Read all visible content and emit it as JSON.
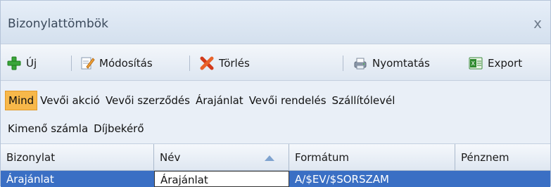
{
  "window": {
    "title": "Bizonylattömbök",
    "close_label": "x"
  },
  "toolbar": {
    "new_label": "Új",
    "edit_label": "Módosítás",
    "delete_label": "Törlés",
    "print_label": "Nyomtatás",
    "export_label": "Export",
    "icons": [
      "plus-icon",
      "edit-icon",
      "delete-icon",
      "printer-icon",
      "excel-icon"
    ]
  },
  "filters": {
    "row1": [
      "Mind",
      "Vevői akció",
      "Vevői szerződés",
      "Árajánlat",
      "Vevői rendelés",
      "Szállítólevél"
    ],
    "row2": [
      "Kimenő számla",
      "Díjbekérő"
    ],
    "active": "Mind"
  },
  "grid": {
    "columns": [
      "Bizonylat",
      "Név",
      "Formátum",
      "Pénznem"
    ],
    "rows": [
      {
        "bizonylat": "Árajánlat",
        "nev": "Árajánlat",
        "formatum": "A/$EV/$SORSZAM",
        "penznem": ""
      }
    ]
  },
  "colors": {
    "accent": "#f7b84a",
    "selection": "#3a6fc4"
  }
}
